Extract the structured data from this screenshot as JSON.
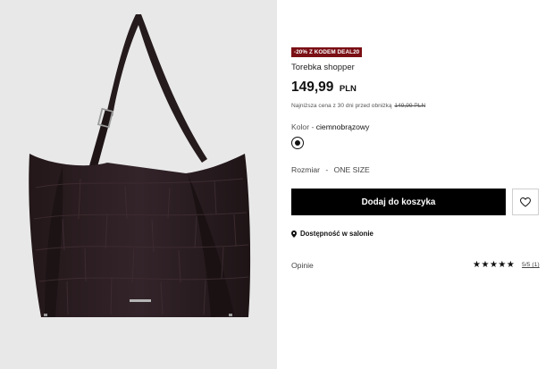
{
  "promo": {
    "badge": "-20% Z KODEM DEAL20"
  },
  "product": {
    "name": "Torebka shopper",
    "price_amount": "149,99",
    "price_currency": "PLN",
    "lowest_price_text": "Najniższa cena z 30 dni przed obniżką",
    "old_price": "149,99 PLN"
  },
  "color": {
    "label": "Kolor",
    "separator": "-",
    "value": "ciemnobrązowy",
    "swatch_color": "#111111"
  },
  "size": {
    "label": "Rozmiar",
    "separator": "-",
    "value": "ONE SIZE"
  },
  "actions": {
    "add_to_cart": "Dodaj do koszyka",
    "wishlist_icon": "heart-icon"
  },
  "availability": {
    "label": "Dostępność w salonie",
    "icon": "location-pin-icon"
  },
  "reviews": {
    "label": "Opinie",
    "stars_filled": 5,
    "stars_total": 5,
    "rating_text": "5/5 (1)"
  },
  "colors": {
    "promo_badge": "#7a0f14",
    "button": "#000000",
    "image_bg": "#e8e8e8",
    "bag": "#2a1d1f"
  }
}
